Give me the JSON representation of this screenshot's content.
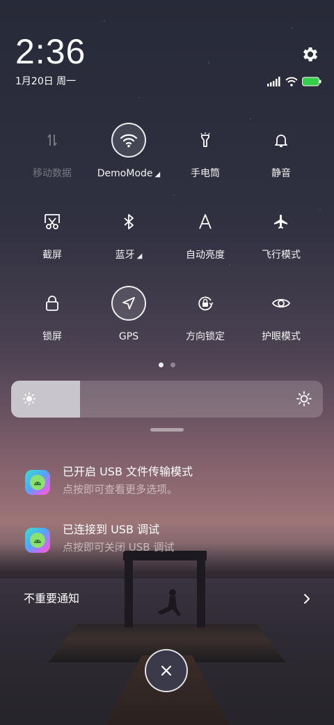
{
  "status": {
    "time": "2:36",
    "date": "1月20日 周一"
  },
  "toggles": [
    {
      "label": "移动数据",
      "icon": "mobile-data-icon",
      "state": "disabled"
    },
    {
      "label": "DemoMode",
      "icon": "wifi-icon",
      "state": "on",
      "has_expand": true
    },
    {
      "label": "手电筒",
      "icon": "flashlight-icon",
      "state": "off"
    },
    {
      "label": "静音",
      "icon": "bell-icon",
      "state": "off"
    },
    {
      "label": "截屏",
      "icon": "screenshot-icon",
      "state": "off"
    },
    {
      "label": "蓝牙",
      "icon": "bluetooth-icon",
      "state": "off",
      "has_expand": true
    },
    {
      "label": "自动亮度",
      "icon": "auto-brightness-icon",
      "state": "off"
    },
    {
      "label": "飞行模式",
      "icon": "airplane-icon",
      "state": "off"
    },
    {
      "label": "锁屏",
      "icon": "lock-icon",
      "state": "off"
    },
    {
      "label": "GPS",
      "icon": "location-arrow-icon",
      "state": "on"
    },
    {
      "label": "方向锁定",
      "icon": "rotation-lock-icon",
      "state": "off"
    },
    {
      "label": "护眼模式",
      "icon": "eye-icon",
      "state": "off"
    }
  ],
  "page_indicator": {
    "pages": 2,
    "current": 1
  },
  "brightness": {
    "level_fraction": 0.22
  },
  "notifications": [
    {
      "title": "已开启 USB 文件传输模式",
      "subtitle": "点按即可查看更多选项。"
    },
    {
      "title": "已连接到 USB 调试",
      "subtitle": "点按即可关闭 USB 调试"
    }
  ],
  "unimportant": {
    "label": "不重要通知"
  },
  "colors": {
    "battery": "#35d04a",
    "brightness_fill": "#c9c5cc"
  }
}
